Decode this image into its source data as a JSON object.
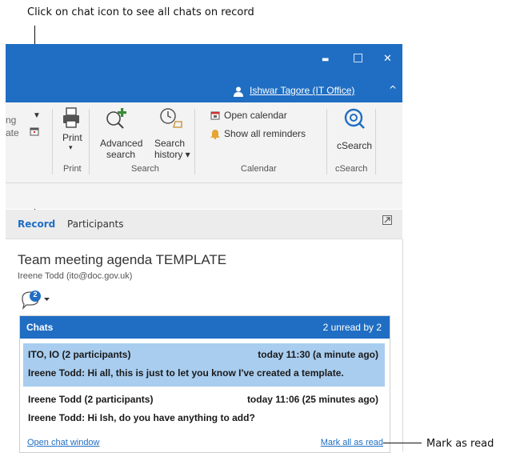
{
  "annotations": {
    "top": "Click on chat icon to see all chats on record",
    "right": "Mark as read"
  },
  "window": {
    "minimize_glyph": "▬",
    "maximize_glyph": "□",
    "close_glyph": "✕",
    "collapse_glyph": "^",
    "user_name": "Ishwar Tagore (IT Office)",
    "accent": "#1f6ec3"
  },
  "ribbon": {
    "left_fragments": [
      "ng",
      "ate"
    ],
    "print": {
      "label": "Print",
      "caret": "▾",
      "group": "Print"
    },
    "advanced_search": {
      "line1": "Advanced",
      "line2": "search"
    },
    "search_history": {
      "line1": "Search",
      "line2": "history ▾"
    },
    "search_group": "Search",
    "open_calendar": "Open calendar",
    "show_all_reminders": "Show all reminders",
    "calendar_group": "Calendar",
    "csearch": {
      "label": "cSearch",
      "group": "cSearch"
    }
  },
  "tabs": {
    "record": "Record",
    "participants": "Participants"
  },
  "record": {
    "title": "Team meeting agenda TEMPLATE",
    "author": "Ireene Todd (ito@doc.gov.uk)",
    "unread_badge": "2"
  },
  "chats": {
    "header": "Chats",
    "unread_summary": "2 unread by 2",
    "items": [
      {
        "participants": "ITO, IO (2 participants)",
        "time": "today 11:30 (a minute ago)",
        "message": "Ireene Todd: Hi all, this is just to let you know I've created a template."
      },
      {
        "participants": "Ireene Todd (2 participants)",
        "time": "today 11:06 (25 minutes ago)",
        "message": "Ireene Todd: Hi Ish, do you have anything to add?"
      }
    ],
    "open_chat_window": "Open chat window",
    "mark_all_read": "Mark all as read",
    "selected_color": "#a9cdef"
  }
}
